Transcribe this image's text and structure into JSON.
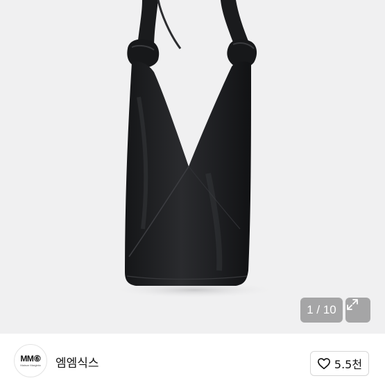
{
  "product": {
    "image_alt_icon": "black-leather-tote-bag",
    "counter_current": "1",
    "counter_total": "10",
    "counter_text": "1 / 10"
  },
  "seller": {
    "logo_text": "MM⑥",
    "logo_subtext": "Maison Margiela",
    "name": "엠엠식스"
  },
  "like": {
    "count": "5.5천",
    "icon": "heart-outline-icon"
  },
  "icons": {
    "expand": "expand-arrows-icon"
  },
  "colors": {
    "background": "#f0f0f1",
    "bag": "#1c1d1f",
    "overlay": "#7a7a7a"
  }
}
